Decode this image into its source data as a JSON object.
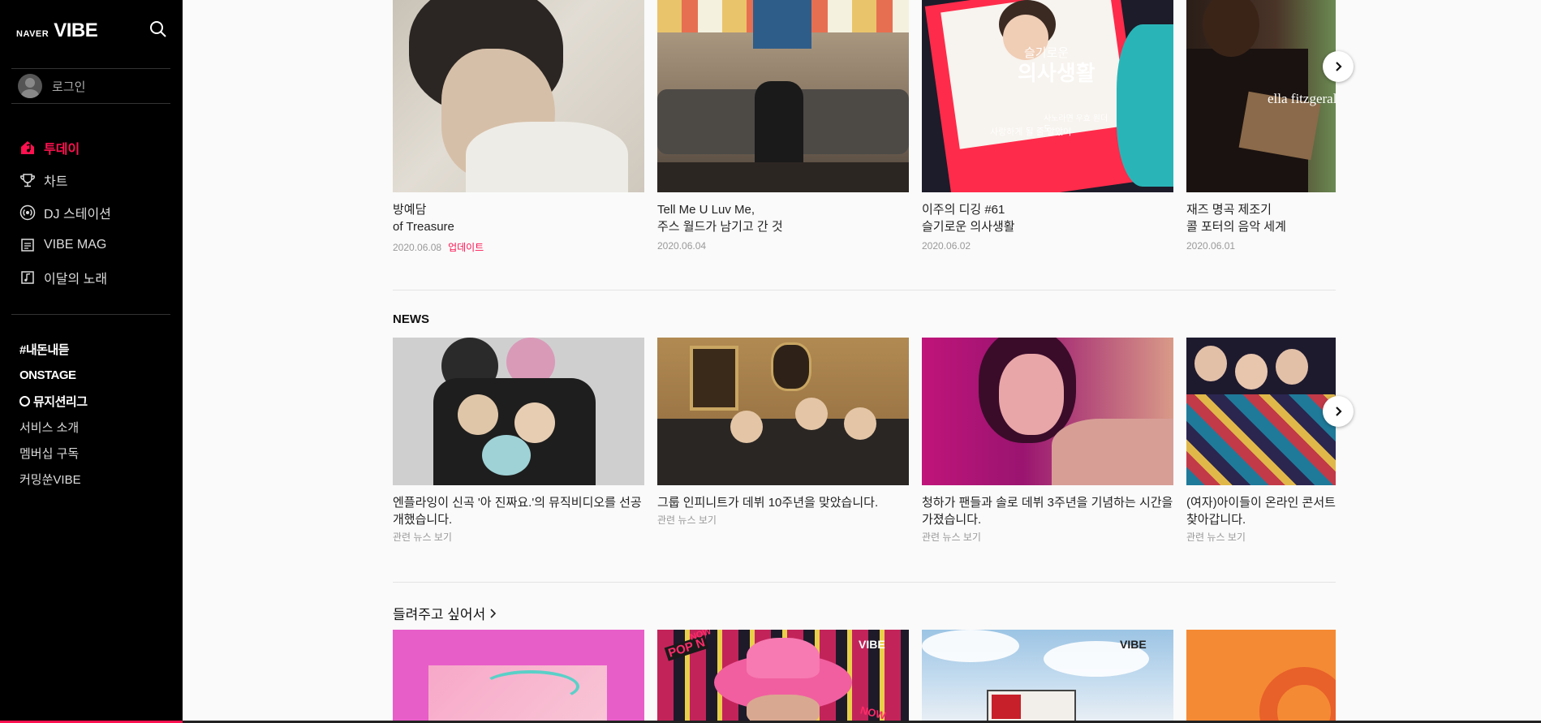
{
  "sidebar": {
    "logo_small": "NAVER",
    "logo_main": "VIBE",
    "login_label": "로그인",
    "nav": [
      {
        "label": "투데이",
        "icon": "home-music-icon",
        "active": true
      },
      {
        "label": "차트",
        "icon": "trophy-icon",
        "active": false
      },
      {
        "label": "DJ 스테이션",
        "icon": "radio-icon",
        "active": false
      },
      {
        "label": "VIBE MAG",
        "icon": "magazine-icon",
        "active": false
      },
      {
        "label": "이달의 노래",
        "icon": "music-note-icon",
        "active": false
      }
    ],
    "sub_nav": [
      {
        "label": "#내돈내듣",
        "brand": true
      },
      {
        "label": "ONSTAGE",
        "brand": true
      },
      {
        "label": "뮤지션리그",
        "brand": true
      },
      {
        "label": "서비스 소개",
        "brand": false
      },
      {
        "label": "멤버십 구독",
        "brand": false
      },
      {
        "label": "커밍쑨VIBE",
        "brand": false
      }
    ]
  },
  "top_row": [
    {
      "title_line1": "방예담",
      "title_line2": "of Treasure",
      "date": "2020.06.08",
      "badge": "업데이트"
    },
    {
      "title_line1": "Tell Me U Luv Me,",
      "title_line2": "주스 월드가 남기고 간 것",
      "date": "2020.06.04",
      "badge": ""
    },
    {
      "title_line1": "이주의 디깅 #61",
      "title_line2": "슬기로운 의사생활",
      "date": "2020.06.02",
      "badge": ""
    },
    {
      "title_line1": "재즈 명곡 제조기",
      "title_line2": "콜 포터의 음악 세계",
      "date": "2020.06.01",
      "badge": ""
    }
  ],
  "top_row_overlay": {
    "card3_text1": "슬기로운",
    "card3_text2": "의사생활",
    "card3_text3": "사랑하게 될 줄 알았어",
    "card3_text4": "사노라면 우효 원더도",
    "card4_text": "ella fitzgerald"
  },
  "news": {
    "heading": "NEWS",
    "items": [
      {
        "title": "엔플라잉이 신곡 '아 진짜요.'의 뮤직비디오를 선공개했습니다.",
        "link": "관련 뉴스 보기"
      },
      {
        "title": "그룹 인피니트가 데뷔 10주년을 맞았습니다.",
        "link": "관련 뉴스 보기"
      },
      {
        "title": "청하가 팬들과 솔로 데뷔 3주년을 기념하는 시간을 가졌습니다.",
        "link": "관련 뉴스 보기"
      },
      {
        "title": "(여자)아이들이 온라인 콘서트로 전 세계 팬들을 찾아갑니다.",
        "link": "관련 뉴스 보기"
      }
    ]
  },
  "listen": {
    "heading": "들려주고 싶어서",
    "badge": "VIBE",
    "pop_text": "POP N",
    "now_text": "NOW"
  },
  "colors": {
    "accent": "#ff1150",
    "sidebar_bg": "#000000",
    "content_bg": "#fafafa"
  }
}
